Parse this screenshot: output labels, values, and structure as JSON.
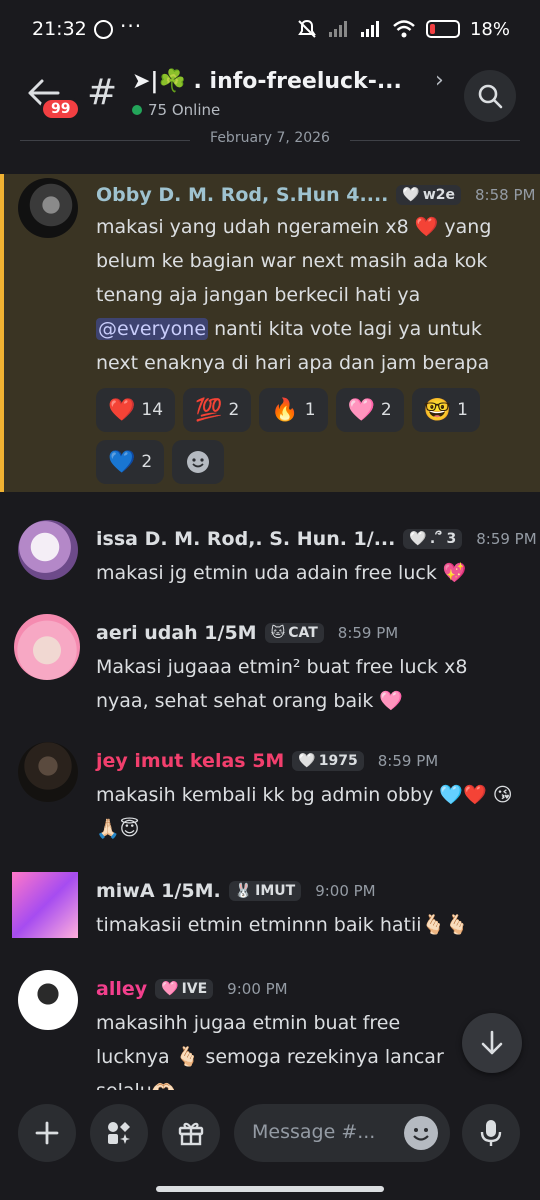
{
  "status_bar": {
    "time": "21:32",
    "dots": "···",
    "battery": "18%",
    "battery_level": 0.18
  },
  "header": {
    "unread_badge": "99",
    "channel_name": "➤|☘️ . info-freeluck-...",
    "chevron": "›",
    "online_count": "75 Online"
  },
  "date_divider": "February 7, 2026",
  "messages": [
    {
      "username": "Obby D. M. Rod, S.Hun 4....",
      "username_color": "#9fc3d0",
      "tag_icon": "🤍",
      "tag": "w2e",
      "time": "8:58 PM",
      "text_before": "makasi yang udah ngeramein x8 ❤️ yang belum ke bagian war next masih ada kok tenang aja jangan berkecil hati ya ",
      "mention": "@everyone",
      "text_after": " nanti kita vote lagi ya untuk next enaknya di hari apa dan jam berapa",
      "reactions": [
        {
          "emoji": "❤️",
          "count": "14"
        },
        {
          "emoji": "💯",
          "count": "2"
        },
        {
          "emoji": "🔥",
          "count": "1"
        },
        {
          "emoji": "🩷",
          "count": "2"
        },
        {
          "emoji": "🤓",
          "count": "1"
        },
        {
          "emoji": "💙",
          "count": "2"
        }
      ]
    },
    {
      "username": "issa D. M. Rod,. S. Hun. 1/...",
      "username_color": "#dbdee1",
      "tag_icon": "🤍",
      "tag": ".՞ 3",
      "time": "8:59 PM",
      "text": "makasi jg etmin uda adain free luck 💖"
    },
    {
      "username": "aeri udah 1/5M",
      "username_color": "#dbdee1",
      "tag_icon": "🐱",
      "tag": "CAT",
      "time": "8:59 PM",
      "text": "Makasi jugaaa etmin² buat free luck x8 nyaa, sehat sehat orang baik 🩷"
    },
    {
      "username": "jey imut kelas 5M",
      "username_color": "#f23f6d",
      "tag_icon": "🤍",
      "tag": "1975",
      "time": "8:59 PM",
      "text": "makasih kembali kk bg admin obby 🩵❤️ 😘🙏🏻😇"
    },
    {
      "username": "miwA 1/5M.",
      "username_color": "#dbdee1",
      "tag_icon": "🐰",
      "tag": "IMUT",
      "time": "9:00 PM",
      "text": "timakasii etmin etminnn baik hatii🫰🏻🫰🏻"
    },
    {
      "username": "alley",
      "username_color": "#f23f8c",
      "tag_icon": "🩷",
      "tag": "IVE",
      "time": "9:00 PM",
      "text": "makasihh jugaa etmin buat free lucknya 🫰🏻 semoga rezekinya lancar selalu🫶🏻"
    }
  ],
  "composer": {
    "placeholder": "Message #..."
  },
  "icons": {
    "back": "arrow-left-icon",
    "search": "search-icon",
    "add": "plus-icon",
    "apps": "apps-icon",
    "gift": "gift-icon",
    "emoji": "emoji-icon",
    "mic": "microphone-icon",
    "jump": "arrow-down-icon"
  },
  "colors": {
    "background": "#1a1a1e",
    "highlight_bg": "#3a3423",
    "highlight_bar": "#f0b232",
    "mention_bg": "#3e4370",
    "online": "#23a55a",
    "badge": "#f23f42"
  }
}
